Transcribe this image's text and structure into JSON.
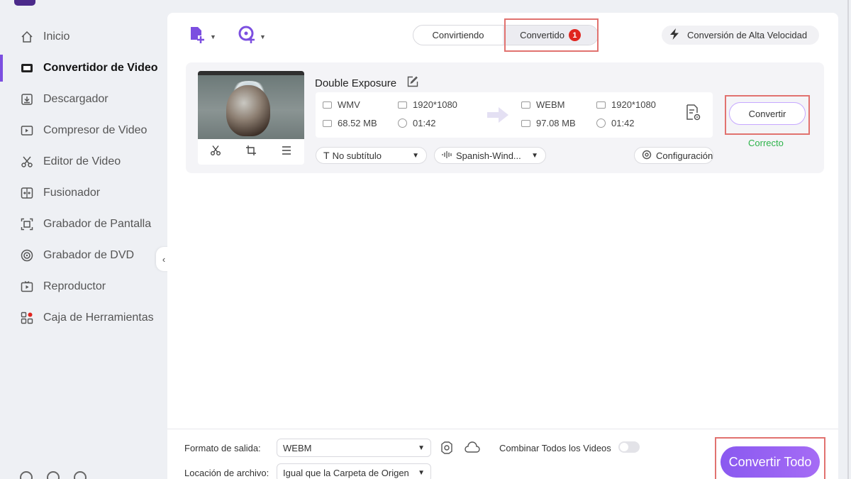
{
  "sidebar": {
    "items": [
      {
        "label": "Inicio",
        "icon": "home-icon"
      },
      {
        "label": "Convertidor de Video",
        "icon": "converter-icon",
        "active": true
      },
      {
        "label": "Descargador",
        "icon": "download-icon"
      },
      {
        "label": "Compresor de Video",
        "icon": "compress-icon"
      },
      {
        "label": "Editor de Video",
        "icon": "scissors-icon"
      },
      {
        "label": "Fusionador",
        "icon": "merge-icon"
      },
      {
        "label": "Grabador de Pantalla",
        "icon": "screen-record-icon"
      },
      {
        "label": "Grabador de DVD",
        "icon": "dvd-icon"
      },
      {
        "label": "Reproductor",
        "icon": "player-icon"
      },
      {
        "label": "Caja de Herramientas",
        "icon": "toolbox-icon"
      }
    ],
    "collapse_glyph": "‹"
  },
  "tabs": {
    "converting": "Convirtiendo",
    "converted": "Convertido",
    "converted_badge": "1"
  },
  "speed": {
    "label": "Conversión de Alta Velocidad"
  },
  "file": {
    "name": "Double Exposure",
    "source": {
      "format": "WMV",
      "resolution": "1920*1080",
      "size": "68.52 MB",
      "duration": "01:42"
    },
    "target": {
      "format": "WEBM",
      "resolution": "1920*1080",
      "size": "97.08 MB",
      "duration": "01:42"
    },
    "subtitle": "No subtítulo",
    "audio": "Spanish-Wind...",
    "settings_label": "Configuración",
    "convert_label": "Convertir",
    "status": "Correcto"
  },
  "bottom": {
    "output_format_label": "Formato de salida:",
    "output_format_value": "WEBM",
    "merge_label": "Combinar Todos los Videos",
    "location_label": "Locación de archivo:",
    "location_value": "Igual que la Carpeta de Origen",
    "convert_all_label": "Convertir Todo"
  },
  "colors": {
    "accent": "#8a59f0",
    "highlight_box": "#e1726f",
    "success": "#2db34a",
    "badge": "#e0251f"
  }
}
